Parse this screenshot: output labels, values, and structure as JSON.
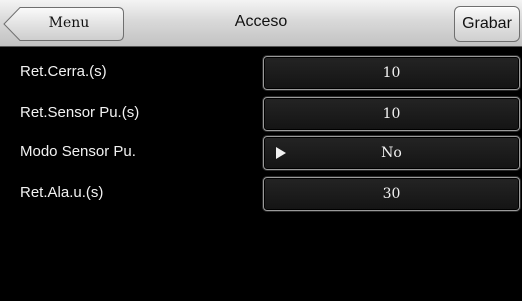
{
  "header": {
    "title": "Acceso",
    "back_label": "Menu",
    "save_label": "Grabar"
  },
  "settings": [
    {
      "label": "Ret.Cerra.(s)",
      "value": "10",
      "has_dropdown": false
    },
    {
      "label": "Ret.Sensor Pu.(s)",
      "value": "10",
      "has_dropdown": false
    },
    {
      "label": "Modo Sensor Pu.",
      "value": "No",
      "has_dropdown": true,
      "icon": "play-arrow-icon"
    },
    {
      "label": "Ret.Ala.u.(s)",
      "value": "30",
      "has_dropdown": false
    }
  ],
  "colors": {
    "background": "#000000",
    "header": "#d9d9d9",
    "text": "#f2f2f2"
  }
}
